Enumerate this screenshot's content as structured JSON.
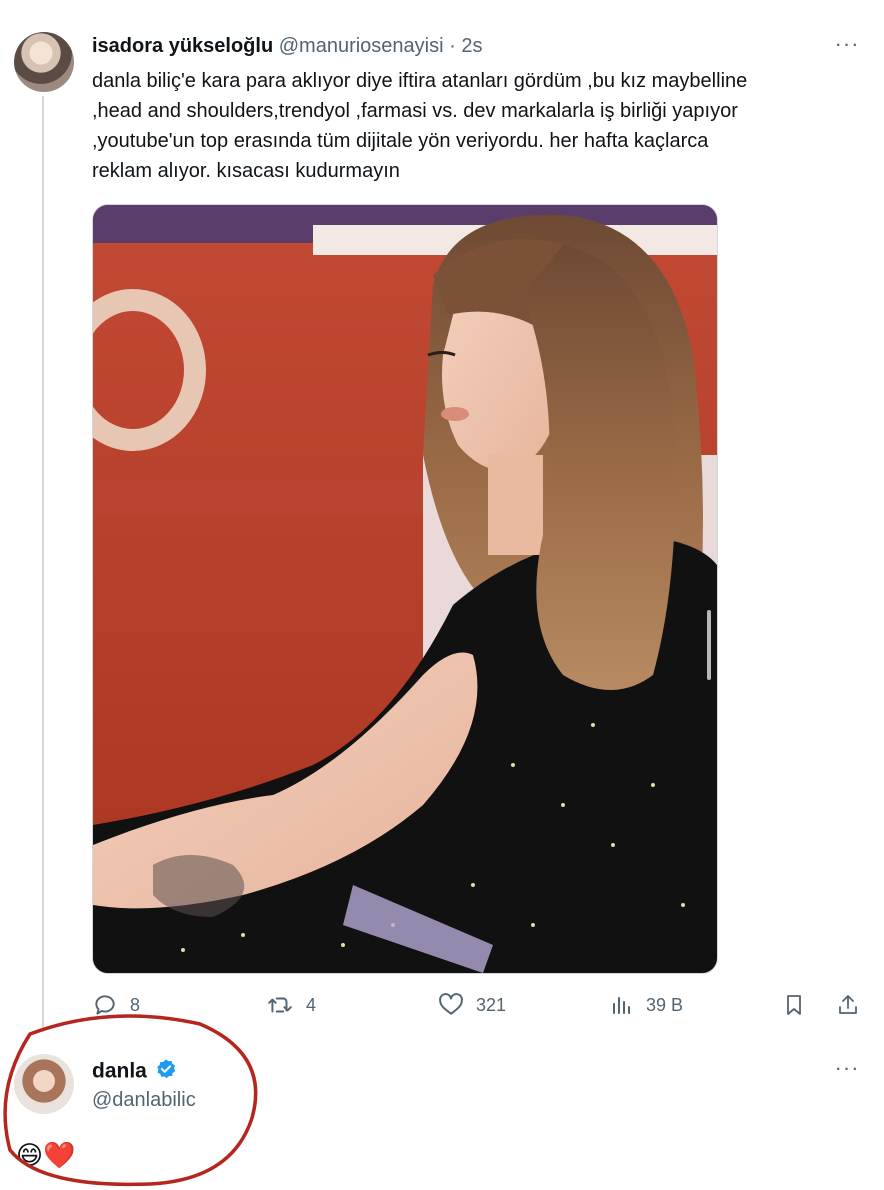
{
  "tweet": {
    "author_name": "isadora yükseloğlu",
    "author_handle": "@manuriosenayisi",
    "separator": "·",
    "time": "2s",
    "more_label": "···",
    "text_lines": [
      "danla biliç'e kara para aklıyor diye iftira atanları gördüm ,bu kız maybelline",
      ",head and shoulders,trendyol ,farmasi vs. dev markalarla iş birliği yapıyor",
      ",youtube'un top erasında tüm dijitale yön veriyordu. her hafta kaçlarca",
      "reklam alıyor. kısacası kudurmayın"
    ],
    "media_icon": "photo-woman-portrait",
    "actions": {
      "reply_count": "8",
      "retweet_count": "4",
      "like_count": "321",
      "views_count": "39 B"
    }
  },
  "reply": {
    "author_name": "danla",
    "author_handle": "@danlabilic",
    "more_label": "···",
    "text": "😄❤️",
    "verified_icon": "verified-badge-icon"
  },
  "colors": {
    "text": "#0f1419",
    "muted": "#536471",
    "verified": "#1d9bf0",
    "annotation": "#b5261e",
    "heart": "#e0245e"
  }
}
